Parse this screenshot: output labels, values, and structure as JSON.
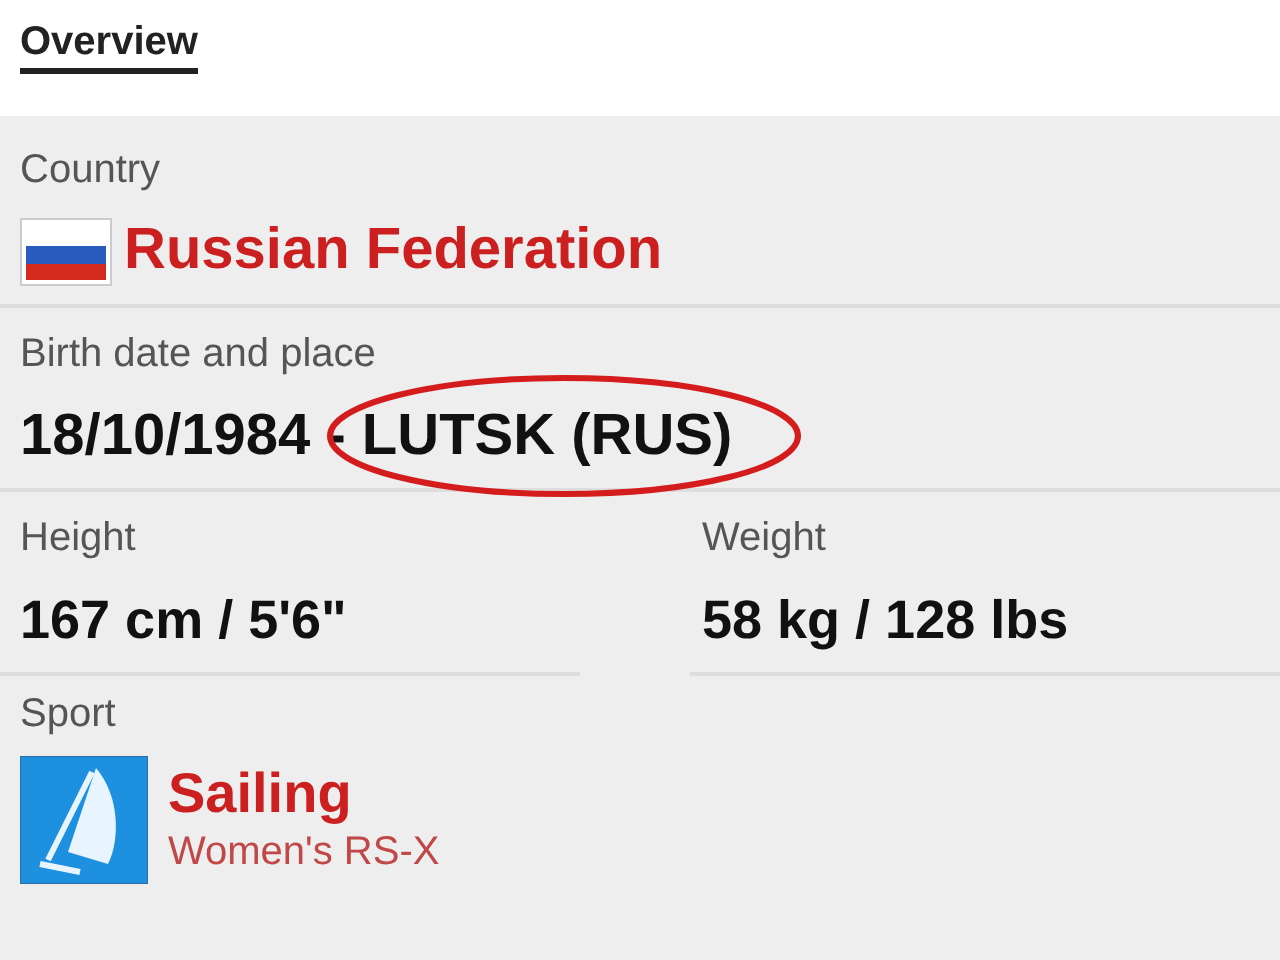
{
  "tab": {
    "label": "Overview",
    "selected": true
  },
  "country": {
    "label": "Country",
    "value": "Russian Federation"
  },
  "birth": {
    "label": "Birth date and place",
    "value": "18/10/1984 - LUTSK (RUS)",
    "circled": true
  },
  "measures": [
    {
      "label": "Height",
      "value": "167 cm / 5'6\""
    },
    {
      "label": "Weight",
      "value": "58 kg / 128 lbs"
    }
  ],
  "sport": {
    "label": "Sport",
    "name": "Sailing",
    "event": "Women's RS-X"
  }
}
